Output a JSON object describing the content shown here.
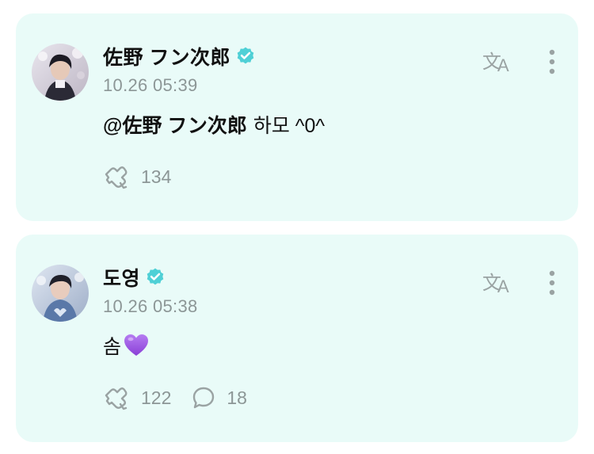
{
  "posts": [
    {
      "author": "佐野 フン次郎",
      "verified": true,
      "timestamp": "10.26 05:39",
      "mention": "@佐野 フン次郎",
      "text": "하모 ^0^",
      "likes": "134",
      "comments": null
    },
    {
      "author": "도영",
      "verified": true,
      "timestamp": "10.26 05:38",
      "text": "솜",
      "emoji": "purple-heart",
      "likes": "122",
      "comments": "18"
    }
  ],
  "colors": {
    "card_bg": "#e9fbf8",
    "verified": "#4fd0d6",
    "icon": "#9aa3a3",
    "muted_text": "#8c9696",
    "heart": "#9b4fe0"
  },
  "icons": {
    "translate": "translate-icon",
    "more": "more-vertical-icon",
    "like": "like-icon",
    "comment": "comment-icon",
    "verified": "verified-badge-icon"
  }
}
